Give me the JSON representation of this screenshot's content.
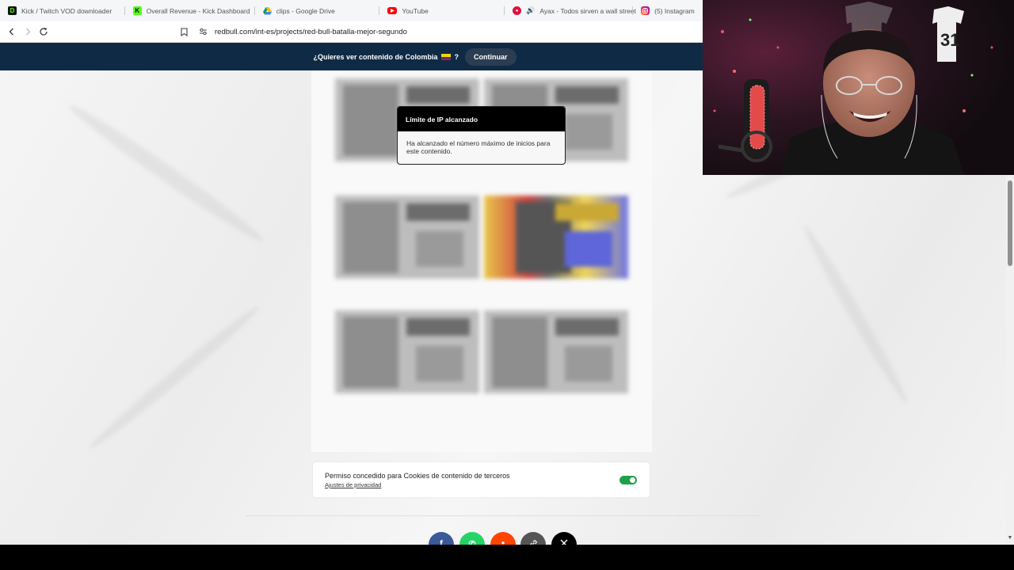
{
  "browser": {
    "tabs": [
      {
        "label": "Kick / Twitch VOD downloader",
        "icon": "kick-d-icon"
      },
      {
        "label": "Overall Revenue - Kick Dashboard",
        "icon": "kick-k-icon"
      },
      {
        "label": "clips - Google Drive",
        "icon": "google-drive-icon"
      },
      {
        "label": "YouTube",
        "icon": "youtube-icon"
      },
      {
        "label": "Ayax - Todos sirven a wall street",
        "icon": "music-icon"
      },
      {
        "label": "(5) Instagram",
        "icon": "instagram-icon"
      }
    ],
    "url": "redbull.com/int-es/projects/red-bull-batalla-mejor-segundo"
  },
  "banner": {
    "question_prefix": "¿Quieres ver contenido de Colombia",
    "question_suffix": "?",
    "continue_label": "Continuar"
  },
  "modal": {
    "title": "Límite de IP alcanzado",
    "message": "Ha alcanzado el número máximo de inicios para este contenido."
  },
  "consent": {
    "title": "Permiso concedido para Cookies de contenido de terceros",
    "link": "Ajustes de privacidad",
    "enabled": true
  },
  "share": [
    {
      "icon": "facebook-icon",
      "glyph": "f",
      "color": "#3b5998"
    },
    {
      "icon": "whatsapp-icon",
      "glyph": "✆",
      "color": "#25d366"
    },
    {
      "icon": "reddit-icon",
      "glyph": "●",
      "color": "#ff4500"
    },
    {
      "icon": "link-icon",
      "glyph": "🔗",
      "color": "#555555"
    },
    {
      "icon": "x-icon",
      "glyph": "𝕏",
      "color": "#000000"
    }
  ],
  "colors": {
    "banner_bg": "#0f2a44",
    "toggle_on": "#1fa14a"
  }
}
